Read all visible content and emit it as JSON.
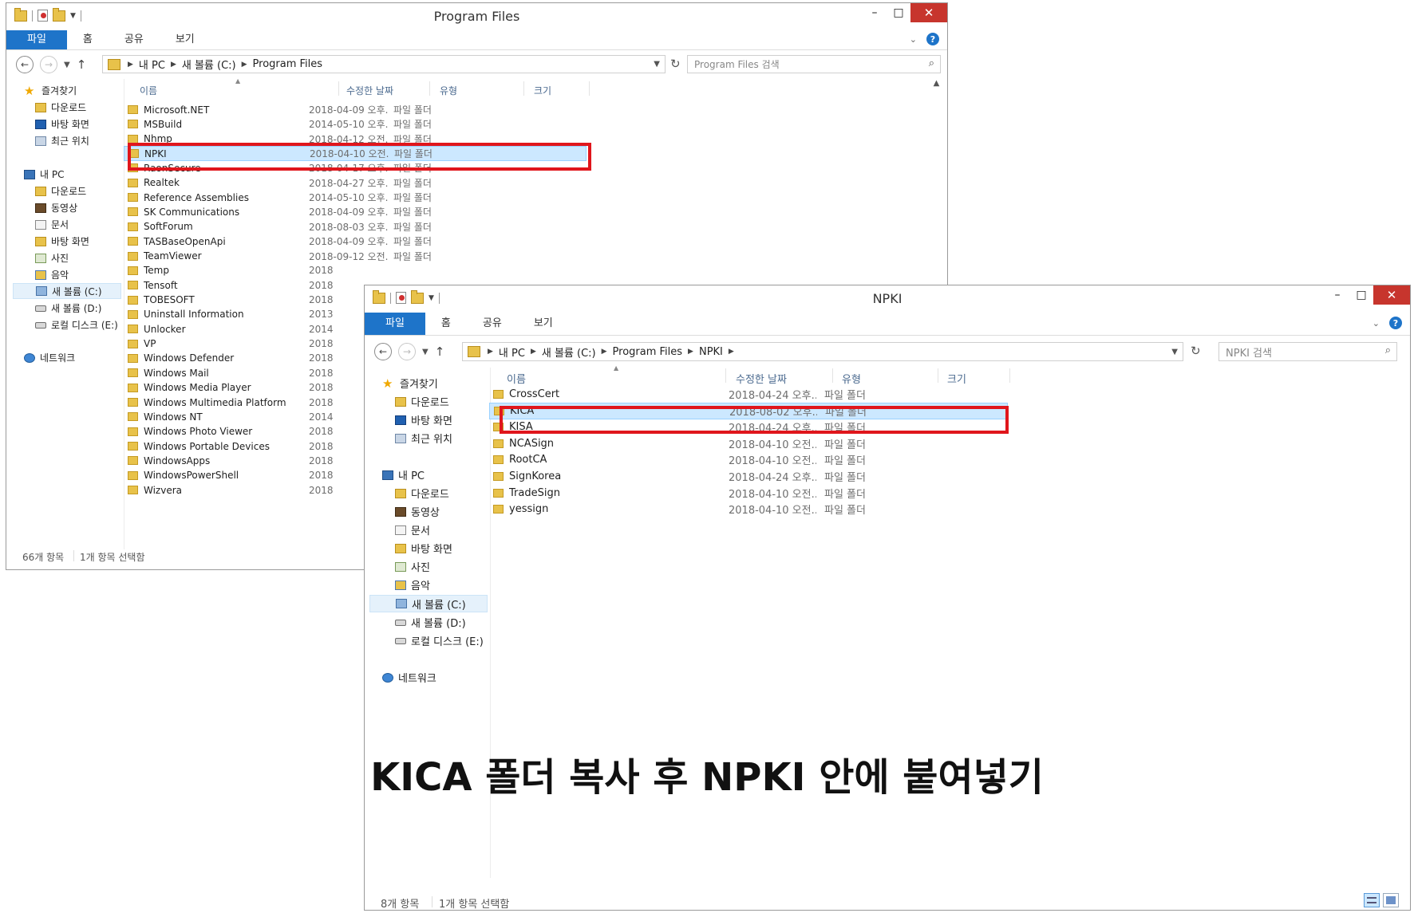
{
  "window_back": {
    "title": "Program Files",
    "ribbon_tabs": [
      "파일",
      "홈",
      "공유",
      "보기"
    ],
    "breadcrumb": [
      "내 PC",
      "새 볼륨 (C:)",
      "Program Files"
    ],
    "search_placeholder": "Program Files 검색",
    "nav": {
      "favorites": "즐겨찾기",
      "favorites_items": [
        "다운로드",
        "바탕 화면",
        "최근 위치"
      ],
      "this_pc": "내 PC",
      "pc_items": [
        "다운로드",
        "동영상",
        "문서",
        "바탕 화면",
        "사진",
        "음악",
        "새 볼륨 (C:)",
        "새 볼륨 (D:)",
        "로컬 디스크 (E:)"
      ],
      "network": "네트워크"
    },
    "columns": [
      "이름",
      "수정한 날짜",
      "유형",
      "크기"
    ],
    "rows": [
      {
        "name": "Microsoft.NET",
        "date": "2018-04-09 오후...",
        "type": "파일 폴더"
      },
      {
        "name": "MSBuild",
        "date": "2014-05-10 오후...",
        "type": "파일 폴더"
      },
      {
        "name": "Nhmp",
        "date": "2018-04-12 오전...",
        "type": "파일 폴더"
      },
      {
        "name": "NPKI",
        "date": "2018-04-10 오전...",
        "type": "파일 폴더"
      },
      {
        "name": "RaonSecure",
        "date": "2018-04-17 오후...",
        "type": "파일 폴더"
      },
      {
        "name": "Realtek",
        "date": "2018-04-27 오후...",
        "type": "파일 폴더"
      },
      {
        "name": "Reference Assemblies",
        "date": "2014-05-10 오후...",
        "type": "파일 폴더"
      },
      {
        "name": "SK Communications",
        "date": "2018-04-09 오후...",
        "type": "파일 폴더"
      },
      {
        "name": "SoftForum",
        "date": "2018-08-03 오후...",
        "type": "파일 폴더"
      },
      {
        "name": "TASBaseOpenApi",
        "date": "2018-04-09 오후...",
        "type": "파일 폴더"
      },
      {
        "name": "TeamViewer",
        "date": "2018-09-12 오전...",
        "type": "파일 폴더"
      },
      {
        "name": "Temp",
        "date": "2018",
        "type": ""
      },
      {
        "name": "Tensoft",
        "date": "2018",
        "type": ""
      },
      {
        "name": "TOBESOFT",
        "date": "2018",
        "type": ""
      },
      {
        "name": "Uninstall Information",
        "date": "2013",
        "type": ""
      },
      {
        "name": "Unlocker",
        "date": "2014",
        "type": ""
      },
      {
        "name": "VP",
        "date": "2018",
        "type": ""
      },
      {
        "name": "Windows Defender",
        "date": "2018",
        "type": ""
      },
      {
        "name": "Windows Mail",
        "date": "2018",
        "type": ""
      },
      {
        "name": "Windows Media Player",
        "date": "2018",
        "type": ""
      },
      {
        "name": "Windows Multimedia Platform",
        "date": "2018",
        "type": ""
      },
      {
        "name": "Windows NT",
        "date": "2014",
        "type": ""
      },
      {
        "name": "Windows Photo Viewer",
        "date": "2018",
        "type": ""
      },
      {
        "name": "Windows Portable Devices",
        "date": "2018",
        "type": ""
      },
      {
        "name": "WindowsApps",
        "date": "2018",
        "type": ""
      },
      {
        "name": "WindowsPowerShell",
        "date": "2018",
        "type": ""
      },
      {
        "name": "Wizvera",
        "date": "2018",
        "type": ""
      }
    ],
    "selected_row": "NPKI",
    "status_count": "66개 항목",
    "status_selected": "1개 항목 선택함"
  },
  "window_front": {
    "title": "NPKI",
    "ribbon_tabs": [
      "파일",
      "홈",
      "공유",
      "보기"
    ],
    "breadcrumb": [
      "내 PC",
      "새 볼륨 (C:)",
      "Program Files",
      "NPKI"
    ],
    "search_placeholder": "NPKI 검색",
    "nav": {
      "favorites": "즐겨찾기",
      "favorites_items": [
        "다운로드",
        "바탕 화면",
        "최근 위치"
      ],
      "this_pc": "내 PC",
      "pc_items": [
        "다운로드",
        "동영상",
        "문서",
        "바탕 화면",
        "사진",
        "음악",
        "새 볼륨 (C:)",
        "새 볼륨 (D:)",
        "로컬 디스크 (E:)"
      ],
      "network": "네트워크"
    },
    "columns": [
      "이름",
      "수정한 날짜",
      "유형",
      "크기"
    ],
    "rows": [
      {
        "name": "CrossCert",
        "date": "2018-04-24 오후...",
        "type": "파일 폴더"
      },
      {
        "name": "KICA",
        "date": "2018-08-02 오후...",
        "type": "파일 폴더"
      },
      {
        "name": "KISA",
        "date": "2018-04-24 오후...",
        "type": "파일 폴더"
      },
      {
        "name": "NCASign",
        "date": "2018-04-10 오전...",
        "type": "파일 폴더"
      },
      {
        "name": "RootCA",
        "date": "2018-04-10 오전...",
        "type": "파일 폴더"
      },
      {
        "name": "SignKorea",
        "date": "2018-04-24 오후...",
        "type": "파일 폴더"
      },
      {
        "name": "TradeSign",
        "date": "2018-04-10 오전...",
        "type": "파일 폴더"
      },
      {
        "name": "yessign",
        "date": "2018-04-10 오전...",
        "type": "파일 폴더"
      }
    ],
    "selected_row": "KICA",
    "status_count": "8개 항목",
    "status_selected": "1개 항목 선택함"
  },
  "caption": "KICA 폴더 복사 후 NPKI 안에 붙여넣기",
  "colors": {
    "accent": "#1e74c9",
    "highlight": "#e0161c",
    "selection": "#cce8ff",
    "close": "#c7352d"
  }
}
